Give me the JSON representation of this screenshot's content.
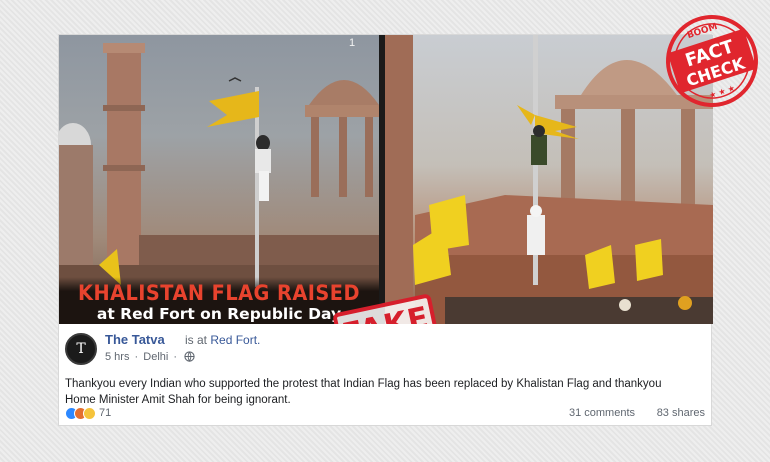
{
  "image": {
    "headline": "KHALISTAN FLAG RAISED",
    "subline": "at Red Fort on Republic Day",
    "slide_marker": "1",
    "stamp_label": "FAKE"
  },
  "badge": {
    "brand": "BOOM",
    "line1": "FACT",
    "line2": "CHECK"
  },
  "post": {
    "avatar_letter": "T",
    "page_name": "The Tatva",
    "checkin_prefix": "is at",
    "location": "Red Fort.",
    "time": "5 hrs",
    "separator": "·",
    "place": "Delhi",
    "separator2": "·",
    "text": "Thankyou every Indian who supported the protest that Indian Flag has been replaced by Khalistan Flag and thankyou Home Minister Amit Shah for being ignorant.",
    "reaction_count": "71",
    "comments": "31 comments",
    "shares": "83 shares"
  },
  "colors": {
    "link_blue": "#385898",
    "stamp_red": "#d61f2c",
    "headline_red": "#e8432e"
  }
}
